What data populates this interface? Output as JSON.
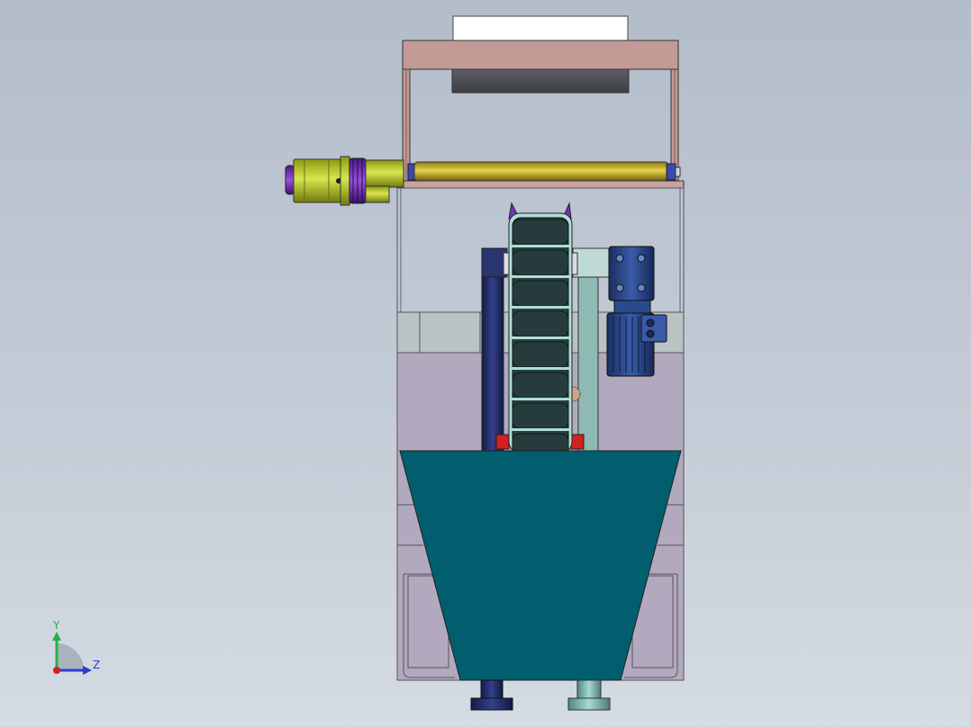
{
  "viewport": {
    "background_top": "#b3bdca",
    "background_bottom": "#d5dbe3"
  },
  "triad": {
    "y_label": "Y",
    "z_label": "Z",
    "colors": {
      "y": "#22b14c",
      "z": "#2b3fd0",
      "x": "#d22020"
    }
  },
  "model": {
    "colors": {
      "frame": "#c9a3a0",
      "tank_fill": "#b3a9be",
      "hopper": "#005e6e",
      "roller": "#c8b22a",
      "drive_motor": "#b7c530",
      "coupling": "#7a2fc2",
      "chain_link": "#263c3c",
      "chain_side": "#b0dcd5",
      "gear_motor": "#2a4a90",
      "legs": "#1c2a6a",
      "leg_right": "#7bb8ac",
      "bearing": "#d42020"
    }
  }
}
